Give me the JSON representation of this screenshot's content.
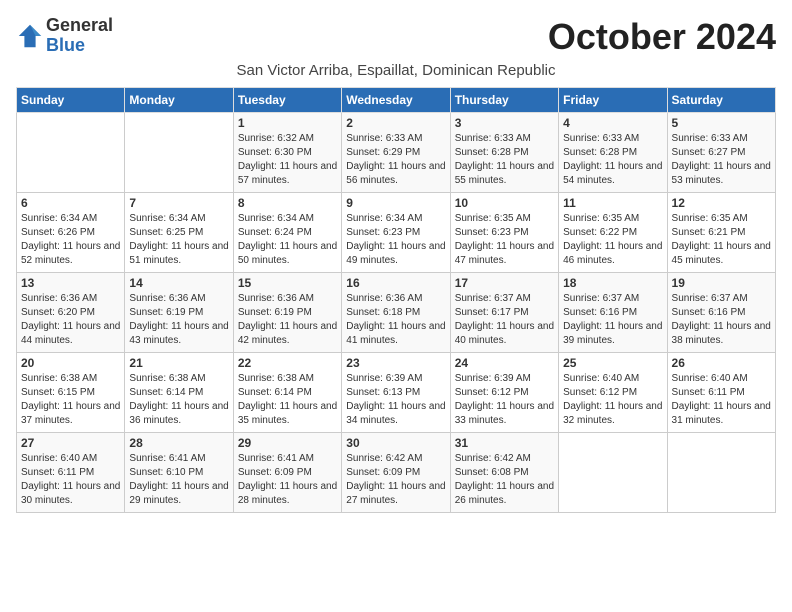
{
  "logo": {
    "general": "General",
    "blue": "Blue"
  },
  "title": "October 2024",
  "subtitle": "San Victor Arriba, Espaillat, Dominican Republic",
  "days_of_week": [
    "Sunday",
    "Monday",
    "Tuesday",
    "Wednesday",
    "Thursday",
    "Friday",
    "Saturday"
  ],
  "weeks": [
    [
      {
        "day": "",
        "info": ""
      },
      {
        "day": "",
        "info": ""
      },
      {
        "day": "1",
        "sunrise": "6:32 AM",
        "sunset": "6:30 PM",
        "daylight": "11 hours and 57 minutes."
      },
      {
        "day": "2",
        "sunrise": "6:33 AM",
        "sunset": "6:29 PM",
        "daylight": "11 hours and 56 minutes."
      },
      {
        "day": "3",
        "sunrise": "6:33 AM",
        "sunset": "6:28 PM",
        "daylight": "11 hours and 55 minutes."
      },
      {
        "day": "4",
        "sunrise": "6:33 AM",
        "sunset": "6:28 PM",
        "daylight": "11 hours and 54 minutes."
      },
      {
        "day": "5",
        "sunrise": "6:33 AM",
        "sunset": "6:27 PM",
        "daylight": "11 hours and 53 minutes."
      }
    ],
    [
      {
        "day": "6",
        "sunrise": "6:34 AM",
        "sunset": "6:26 PM",
        "daylight": "11 hours and 52 minutes."
      },
      {
        "day": "7",
        "sunrise": "6:34 AM",
        "sunset": "6:25 PM",
        "daylight": "11 hours and 51 minutes."
      },
      {
        "day": "8",
        "sunrise": "6:34 AM",
        "sunset": "6:24 PM",
        "daylight": "11 hours and 50 minutes."
      },
      {
        "day": "9",
        "sunrise": "6:34 AM",
        "sunset": "6:23 PM",
        "daylight": "11 hours and 49 minutes."
      },
      {
        "day": "10",
        "sunrise": "6:35 AM",
        "sunset": "6:23 PM",
        "daylight": "11 hours and 47 minutes."
      },
      {
        "day": "11",
        "sunrise": "6:35 AM",
        "sunset": "6:22 PM",
        "daylight": "11 hours and 46 minutes."
      },
      {
        "day": "12",
        "sunrise": "6:35 AM",
        "sunset": "6:21 PM",
        "daylight": "11 hours and 45 minutes."
      }
    ],
    [
      {
        "day": "13",
        "sunrise": "6:36 AM",
        "sunset": "6:20 PM",
        "daylight": "11 hours and 44 minutes."
      },
      {
        "day": "14",
        "sunrise": "6:36 AM",
        "sunset": "6:19 PM",
        "daylight": "11 hours and 43 minutes."
      },
      {
        "day": "15",
        "sunrise": "6:36 AM",
        "sunset": "6:19 PM",
        "daylight": "11 hours and 42 minutes."
      },
      {
        "day": "16",
        "sunrise": "6:36 AM",
        "sunset": "6:18 PM",
        "daylight": "11 hours and 41 minutes."
      },
      {
        "day": "17",
        "sunrise": "6:37 AM",
        "sunset": "6:17 PM",
        "daylight": "11 hours and 40 minutes."
      },
      {
        "day": "18",
        "sunrise": "6:37 AM",
        "sunset": "6:16 PM",
        "daylight": "11 hours and 39 minutes."
      },
      {
        "day": "19",
        "sunrise": "6:37 AM",
        "sunset": "6:16 PM",
        "daylight": "11 hours and 38 minutes."
      }
    ],
    [
      {
        "day": "20",
        "sunrise": "6:38 AM",
        "sunset": "6:15 PM",
        "daylight": "11 hours and 37 minutes."
      },
      {
        "day": "21",
        "sunrise": "6:38 AM",
        "sunset": "6:14 PM",
        "daylight": "11 hours and 36 minutes."
      },
      {
        "day": "22",
        "sunrise": "6:38 AM",
        "sunset": "6:14 PM",
        "daylight": "11 hours and 35 minutes."
      },
      {
        "day": "23",
        "sunrise": "6:39 AM",
        "sunset": "6:13 PM",
        "daylight": "11 hours and 34 minutes."
      },
      {
        "day": "24",
        "sunrise": "6:39 AM",
        "sunset": "6:12 PM",
        "daylight": "11 hours and 33 minutes."
      },
      {
        "day": "25",
        "sunrise": "6:40 AM",
        "sunset": "6:12 PM",
        "daylight": "11 hours and 32 minutes."
      },
      {
        "day": "26",
        "sunrise": "6:40 AM",
        "sunset": "6:11 PM",
        "daylight": "11 hours and 31 minutes."
      }
    ],
    [
      {
        "day": "27",
        "sunrise": "6:40 AM",
        "sunset": "6:11 PM",
        "daylight": "11 hours and 30 minutes."
      },
      {
        "day": "28",
        "sunrise": "6:41 AM",
        "sunset": "6:10 PM",
        "daylight": "11 hours and 29 minutes."
      },
      {
        "day": "29",
        "sunrise": "6:41 AM",
        "sunset": "6:09 PM",
        "daylight": "11 hours and 28 minutes."
      },
      {
        "day": "30",
        "sunrise": "6:42 AM",
        "sunset": "6:09 PM",
        "daylight": "11 hours and 27 minutes."
      },
      {
        "day": "31",
        "sunrise": "6:42 AM",
        "sunset": "6:08 PM",
        "daylight": "11 hours and 26 minutes."
      },
      {
        "day": "",
        "info": ""
      },
      {
        "day": "",
        "info": ""
      }
    ]
  ]
}
